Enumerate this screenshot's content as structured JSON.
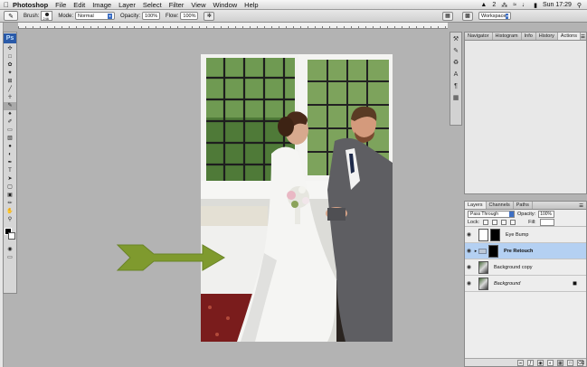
{
  "menubar": {
    "app": "Photoshop",
    "items": [
      "File",
      "Edit",
      "Image",
      "Layer",
      "Select",
      "Filter",
      "View",
      "Window",
      "Help"
    ],
    "status_badge": "2",
    "clock": "Sun 17:29"
  },
  "options_bar": {
    "brush_label": "Brush:",
    "brush_size": "246",
    "mode_label": "Mode:",
    "mode_value": "Normal",
    "opacity_label": "Opacity:",
    "opacity_value": "100%",
    "flow_label": "Flow:",
    "flow_value": "100%",
    "workspace_label": "Workspace"
  },
  "toolbox": {
    "logo": "Ps"
  },
  "dock_tabs": [
    "Navigator",
    "Histogram",
    "Info",
    "History",
    "Actions"
  ],
  "layers_panel": {
    "tabs": [
      "Layers",
      "Channels",
      "Paths"
    ],
    "blend_mode": "Pass Through",
    "opacity_label": "Opacity:",
    "opacity_value": "100%",
    "lock_label": "Lock:",
    "fill_label": "Fill:",
    "layers": [
      {
        "name": "Eye Bump",
        "selected": false
      },
      {
        "name": "Pre Retouch",
        "selected": true
      },
      {
        "name": "Background copy",
        "selected": false
      },
      {
        "name": "Background",
        "selected": false
      }
    ]
  },
  "colors": {
    "accent": "#2a5aa8",
    "selected_layer": "#b4d0f2",
    "arrow": "#7f9a2e"
  }
}
